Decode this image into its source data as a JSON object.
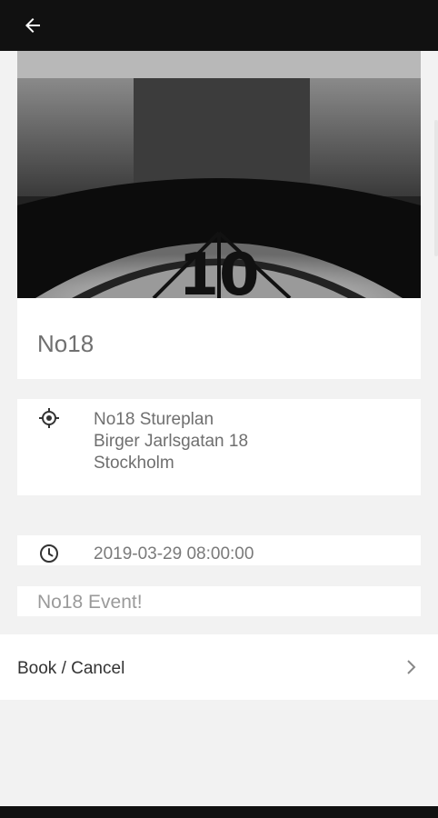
{
  "header": {
    "back_icon": "arrow-left-icon"
  },
  "event": {
    "title": "No18",
    "location": {
      "icon": "location-target-icon",
      "line1": "No18 Stureplan",
      "line2": "Birger Jarlsgatan 18",
      "line3": "Stockholm"
    },
    "datetime": {
      "icon": "clock-icon",
      "value": "2019-03-29 08:00:00"
    },
    "description": "No18 Event!",
    "hero_number": "10"
  },
  "actions": {
    "book_label": "Book / Cancel",
    "chevron_icon": "chevron-right-icon"
  },
  "colors": {
    "topbar": "#111111",
    "background": "#f2f2f2",
    "card": "#ffffff"
  }
}
